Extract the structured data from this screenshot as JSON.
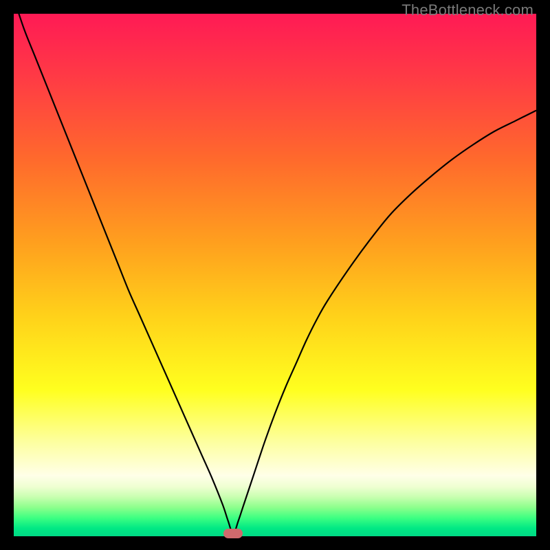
{
  "watermark": "TheBottleneck.com",
  "colors": {
    "frame": "#000000",
    "gradient_stops": [
      {
        "offset": 0.0,
        "color": "#ff1a55"
      },
      {
        "offset": 0.12,
        "color": "#ff3a45"
      },
      {
        "offset": 0.28,
        "color": "#ff6a2c"
      },
      {
        "offset": 0.44,
        "color": "#ffa01e"
      },
      {
        "offset": 0.58,
        "color": "#ffd21a"
      },
      {
        "offset": 0.72,
        "color": "#ffff1f"
      },
      {
        "offset": 0.82,
        "color": "#fdffa0"
      },
      {
        "offset": 0.884,
        "color": "#ffffe8"
      },
      {
        "offset": 0.905,
        "color": "#efffd2"
      },
      {
        "offset": 0.925,
        "color": "#c8ffb0"
      },
      {
        "offset": 0.945,
        "color": "#8cff8c"
      },
      {
        "offset": 0.965,
        "color": "#3dff82"
      },
      {
        "offset": 0.985,
        "color": "#00e884"
      },
      {
        "offset": 1.0,
        "color": "#00d985"
      }
    ],
    "curve": "#000000",
    "marker": "#cf6a6d"
  },
  "chart_data": {
    "type": "line",
    "title": "",
    "xlabel": "",
    "ylabel": "",
    "xlim": [
      0,
      100
    ],
    "ylim": [
      0,
      100
    ],
    "min_x": 42,
    "series": [
      {
        "name": "bottleneck-curve",
        "x": [
          0,
          2,
          4,
          6,
          8,
          10,
          12,
          14,
          16,
          18,
          20,
          22,
          24,
          26,
          28,
          30,
          32,
          34,
          36,
          38,
          40,
          41,
          42,
          43,
          44,
          46,
          48,
          50,
          52,
          54,
          56,
          58,
          60,
          64,
          68,
          72,
          76,
          80,
          84,
          88,
          92,
          96,
          100
        ],
        "y": [
          103,
          97,
          92,
          87,
          82,
          77,
          72,
          67,
          62,
          57,
          52,
          47,
          42.5,
          38,
          33.5,
          29,
          24.5,
          20,
          15.5,
          11,
          6,
          3,
          0.5,
          3,
          6,
          12,
          18,
          23.5,
          28.5,
          33,
          37.5,
          41.5,
          45,
          51,
          56.5,
          61.5,
          65.5,
          69,
          72.2,
          75,
          77.5,
          79.5,
          81.5
        ]
      }
    ],
    "marker": {
      "x": 42,
      "y": 0.5
    }
  }
}
